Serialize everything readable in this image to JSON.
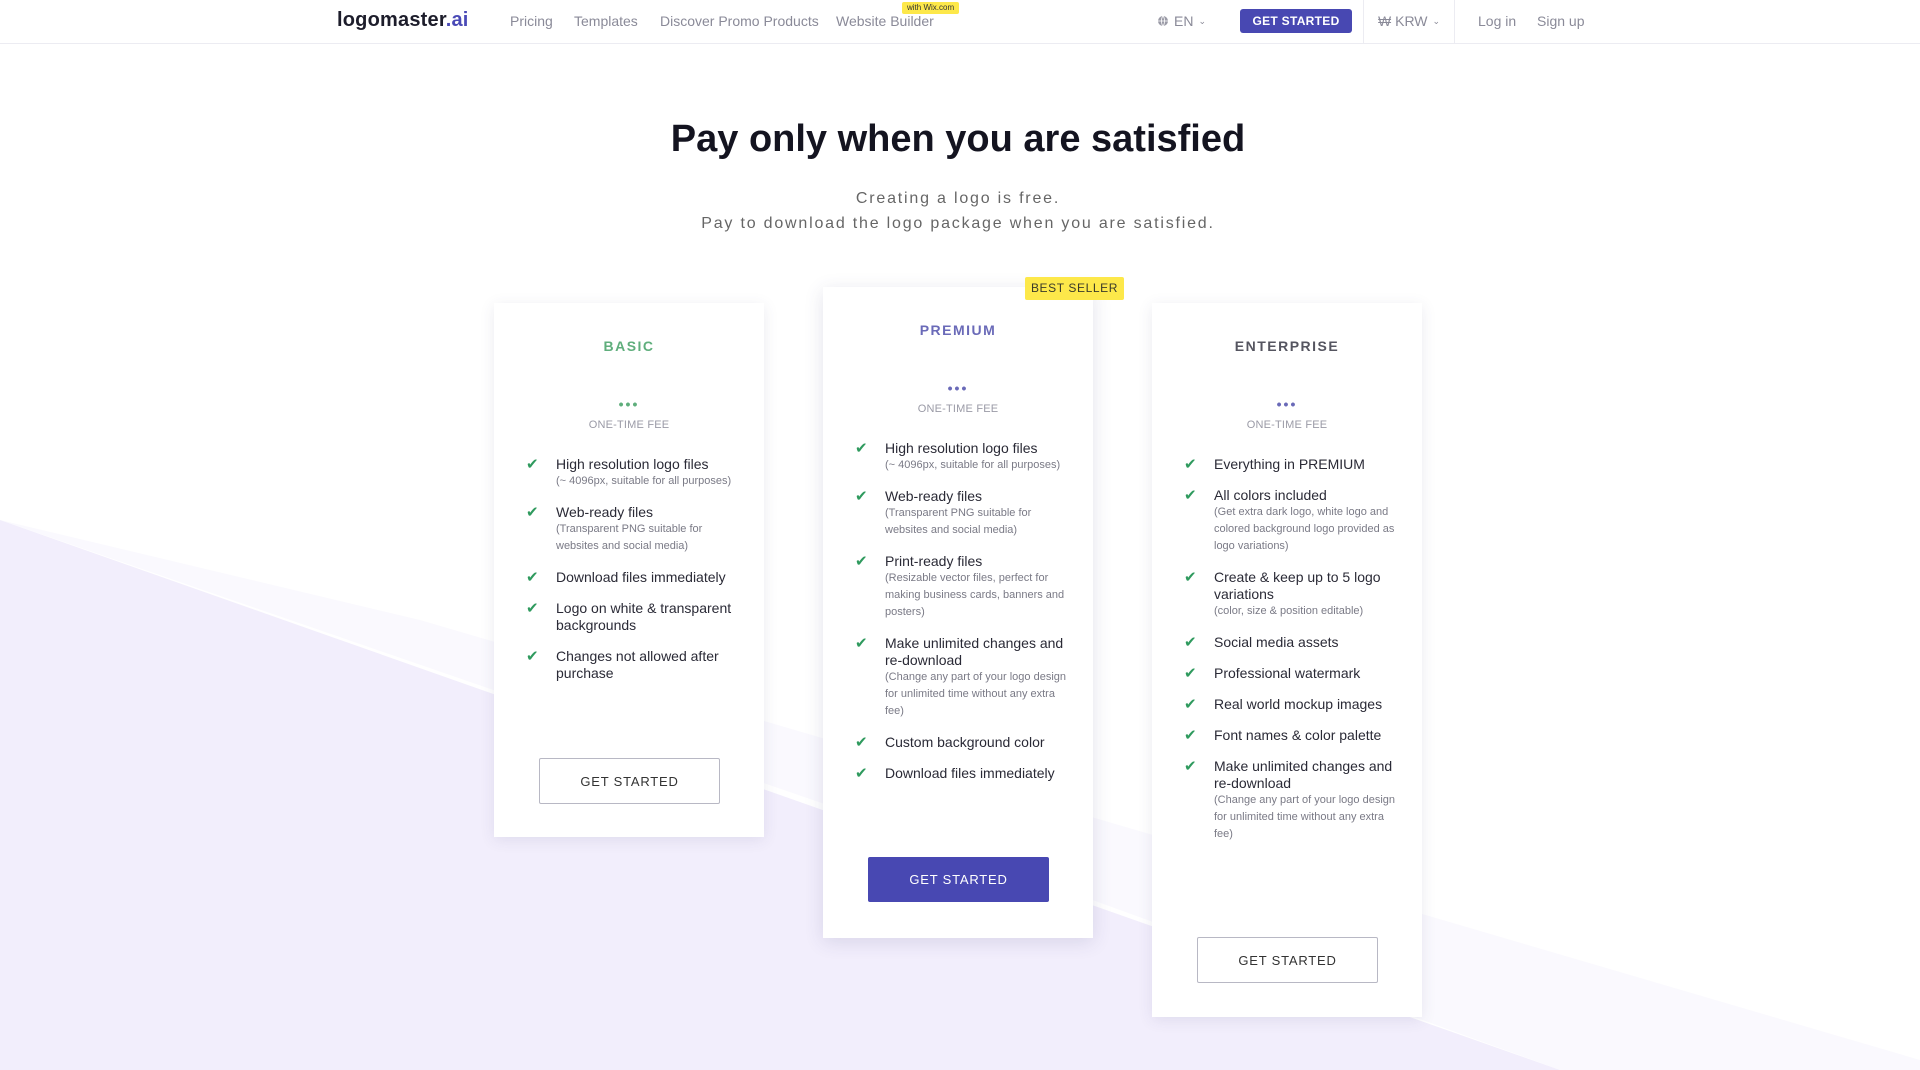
{
  "colors": {
    "accent": "#4848b2",
    "basic": "#5fae7c",
    "premium": "#6a6ab8",
    "enterprise": "#555560",
    "check": "#2f9a5e",
    "badge": "#fde84a"
  },
  "nav": {
    "logo_main": "logomaster",
    "logo_ai": ".ai",
    "links": [
      "Pricing",
      "Templates",
      "Discover Promo Products",
      "Website Builder"
    ],
    "wix_badge": "with Wix.com",
    "language": "EN",
    "cta": "GET STARTED",
    "currency": "₩ KRW",
    "login": "Log in",
    "signup": "Sign up"
  },
  "hero": {
    "title": "Pay only when you are satisfied",
    "subtitle_1": "Creating a logo is free.",
    "subtitle_2": "Pay to download the logo package when you are satisfied."
  },
  "plans": [
    {
      "name": "BASIC",
      "price": "•••",
      "fee": "ONE-TIME FEE",
      "features": [
        {
          "main": "High resolution logo files",
          "sub": "(~ 4096px, suitable for all purposes)"
        },
        {
          "main": "Web-ready files",
          "sub": "(Transparent PNG suitable for websites and social media)"
        },
        {
          "main": "Download files immediately",
          "sub": ""
        },
        {
          "main": "Logo on white & transparent backgrounds",
          "sub": ""
        },
        {
          "main": "Changes not allowed after purchase",
          "sub": ""
        }
      ],
      "button": "GET STARTED"
    },
    {
      "name": "PREMIUM",
      "badge": "BEST SELLER",
      "price": "•••",
      "fee": "ONE-TIME FEE",
      "features": [
        {
          "main": "High resolution logo files",
          "sub": "(~ 4096px, suitable for all purposes)"
        },
        {
          "main": "Web-ready files",
          "sub": "(Transparent PNG suitable for websites and social media)"
        },
        {
          "main": "Print-ready files",
          "sub": "(Resizable vector files, perfect for making business cards, banners and posters)"
        },
        {
          "main": "Make unlimited changes and re-download",
          "sub": "(Change any part of your logo design for unlimited time without any extra fee)"
        },
        {
          "main": "Custom background color",
          "sub": ""
        },
        {
          "main": "Download files immediately",
          "sub": ""
        }
      ],
      "button": "GET STARTED"
    },
    {
      "name": "ENTERPRISE",
      "price": "•••",
      "fee": "ONE-TIME FEE",
      "features": [
        {
          "main": "Everything in PREMIUM",
          "sub": ""
        },
        {
          "main": "All colors included",
          "sub": "(Get extra dark logo, white logo and colored background logo provided as logo variations)"
        },
        {
          "main": "Create & keep up to 5 logo variations",
          "sub": "(color, size & position editable)"
        },
        {
          "main": "Social media assets",
          "sub": ""
        },
        {
          "main": "Professional watermark",
          "sub": ""
        },
        {
          "main": "Real world mockup images",
          "sub": ""
        },
        {
          "main": "Font names & color palette",
          "sub": ""
        },
        {
          "main": "Make unlimited changes and re-download",
          "sub": "(Change any part of your logo design for unlimited time without any extra fee)"
        }
      ],
      "button": "GET STARTED"
    }
  ]
}
